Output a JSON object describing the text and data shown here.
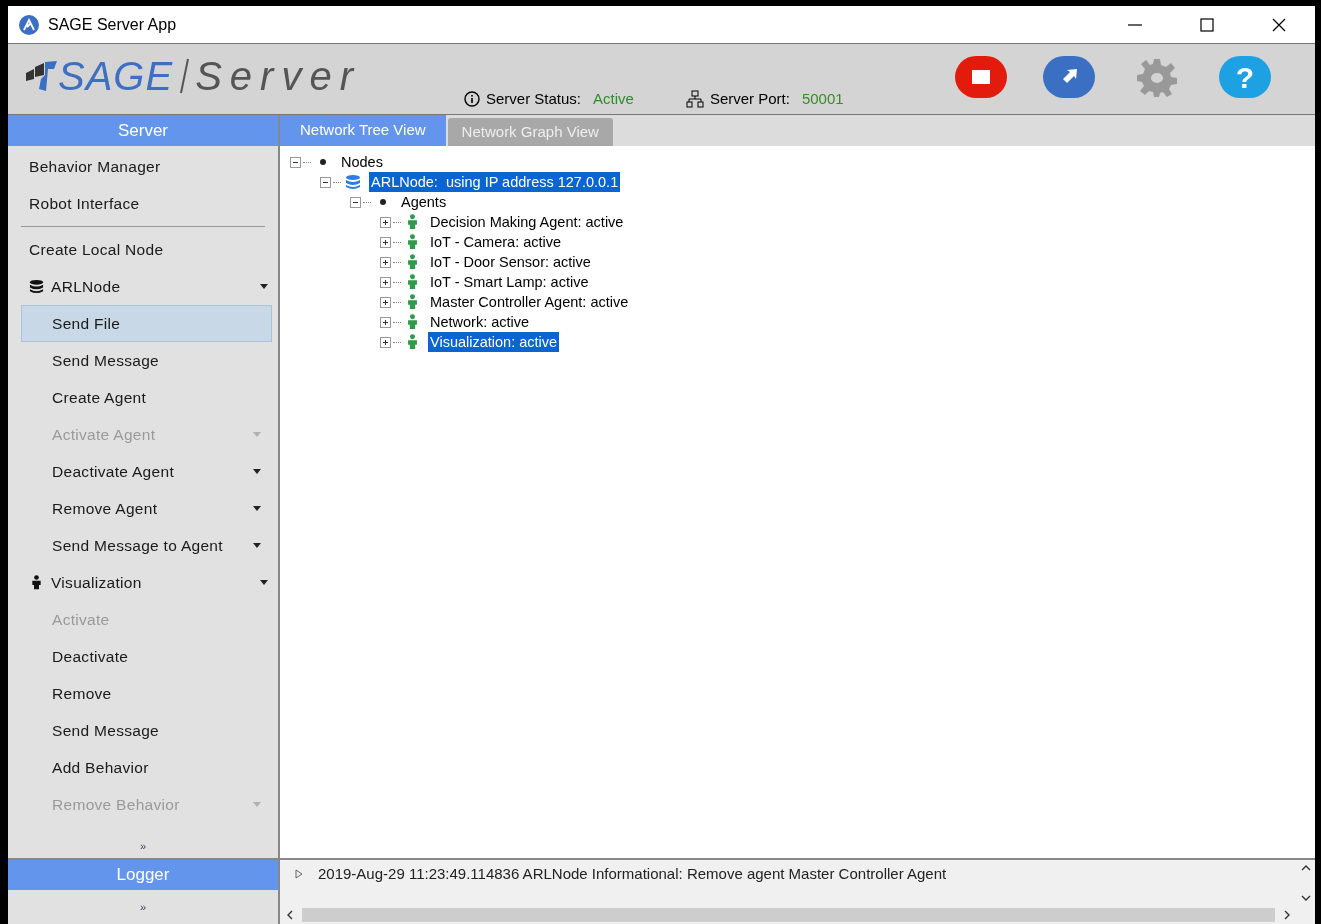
{
  "window": {
    "title": "SAGE Server App"
  },
  "header": {
    "logo_brand": "SAGE",
    "logo_product": "Server",
    "status_label": "Server Status:",
    "status_value": "Active",
    "port_label": "Server Port:",
    "port_value": "50001",
    "toolbar": [
      {
        "kind": "stop",
        "disabled": false
      },
      {
        "kind": "export",
        "disabled": false
      },
      {
        "kind": "settings",
        "disabled": true
      },
      {
        "kind": "help",
        "label": "?",
        "disabled": false
      }
    ]
  },
  "sidebar": {
    "title": "Server",
    "items": [
      {
        "kind": "item",
        "label": "Behavior Manager"
      },
      {
        "kind": "item",
        "label": "Robot Interface"
      },
      {
        "kind": "separator"
      },
      {
        "kind": "item",
        "label": "Create Local Node"
      },
      {
        "kind": "node_group",
        "label": "ARLNode",
        "children": [
          {
            "label": "Send File",
            "selected": true,
            "disabled": false,
            "dropdown": false
          },
          {
            "label": "Send Message",
            "selected": false,
            "disabled": false,
            "dropdown": false
          },
          {
            "label": "Create Agent",
            "selected": false,
            "disabled": false,
            "dropdown": false
          },
          {
            "label": "Activate Agent",
            "selected": false,
            "disabled": true,
            "dropdown": true
          },
          {
            "label": "Deactivate Agent",
            "selected": false,
            "disabled": false,
            "dropdown": true
          },
          {
            "label": "Remove Agent",
            "selected": false,
            "disabled": false,
            "dropdown": true
          },
          {
            "label": "Send Message to Agent",
            "selected": false,
            "disabled": false,
            "dropdown": true
          }
        ]
      },
      {
        "kind": "agent_group",
        "label": "Visualization",
        "children": [
          {
            "label": "Activate",
            "selected": false,
            "disabled": true,
            "dropdown": false
          },
          {
            "label": "Deactivate",
            "selected": false,
            "disabled": false,
            "dropdown": false
          },
          {
            "label": "Remove",
            "selected": false,
            "disabled": false,
            "dropdown": false
          },
          {
            "label": "Send Message",
            "selected": false,
            "disabled": false,
            "dropdown": false
          },
          {
            "label": "Add Behavior",
            "selected": false,
            "disabled": false,
            "dropdown": false
          },
          {
            "label": "Remove Behavior",
            "selected": false,
            "disabled": true,
            "dropdown": true
          }
        ]
      }
    ],
    "more": "»"
  },
  "tabs": [
    {
      "label": "Network Tree View",
      "selected": true
    },
    {
      "label": "Network Graph View",
      "selected": false
    }
  ],
  "tree": [
    {
      "label": "Nodes",
      "kind": "folder",
      "expanded": true,
      "selected": false,
      "children": [
        {
          "label": "ARLNode:  using IP address 127.0.0.1",
          "kind": "node",
          "expanded": true,
          "selected": true,
          "children": [
            {
              "label": "Agents",
              "kind": "folder",
              "expanded": true,
              "selected": false,
              "children": [
                {
                  "label": "Decision Making Agent: active",
                  "kind": "agent",
                  "expanded": false,
                  "selected": false
                },
                {
                  "label": "IoT - Camera: active",
                  "kind": "agent",
                  "expanded": false,
                  "selected": false
                },
                {
                  "label": "IoT - Door Sensor: active",
                  "kind": "agent",
                  "expanded": false,
                  "selected": false
                },
                {
                  "label": "IoT - Smart Lamp: active",
                  "kind": "agent",
                  "expanded": false,
                  "selected": false
                },
                {
                  "label": "Master Controller Agent: active",
                  "kind": "agent",
                  "expanded": false,
                  "selected": false
                },
                {
                  "label": "Network: active",
                  "kind": "agent",
                  "expanded": false,
                  "selected": false
                },
                {
                  "label": "Visualization: active",
                  "kind": "agent",
                  "expanded": false,
                  "selected": true
                }
              ]
            }
          ]
        }
      ]
    }
  ],
  "logger": {
    "title": "Logger",
    "more": "»",
    "entries": [
      {
        "text": "2019-Aug-29 11:23:49.114836 ARLNode Informational: Remove agent Master Controller Agent",
        "expanded": false
      }
    ]
  }
}
